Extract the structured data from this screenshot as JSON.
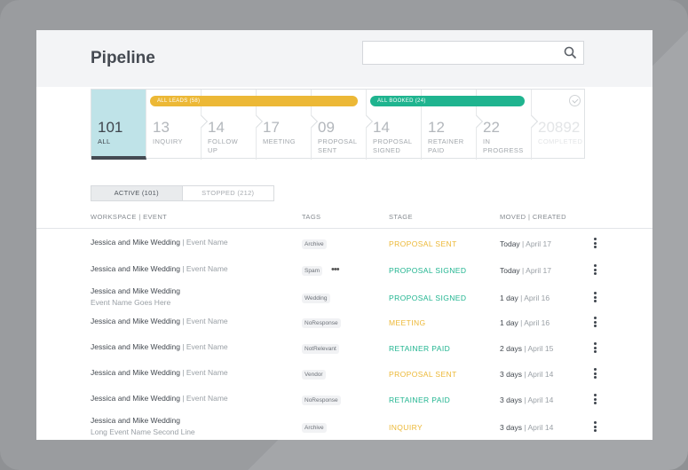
{
  "header": {
    "title": "Pipeline",
    "search_placeholder": ""
  },
  "stages": [
    {
      "count": "101",
      "label": "ALL"
    },
    {
      "count": "13",
      "label": "INQUIRY"
    },
    {
      "count": "14",
      "label": "FOLLOW UP"
    },
    {
      "count": "17",
      "label": "MEETING"
    },
    {
      "count": "09",
      "label": "PROPOSAL SENT"
    },
    {
      "count": "14",
      "label": "PROPOSAL SIGNED"
    },
    {
      "count": "12",
      "label": "RETAINER PAID"
    },
    {
      "count": "22",
      "label": "IN PROGRESS"
    },
    {
      "count": "20892",
      "label": "COMPLETED"
    }
  ],
  "groups": {
    "leads": "ALL LEADS (58)",
    "booked": "ALL BOOKED (24)"
  },
  "filters": {
    "active": "ACTIVE (101)",
    "stopped": "STOPPED (212)"
  },
  "columns": {
    "workspace": "WORKSPACE | EVENT",
    "tags": "TAGS",
    "stage": "STAGE",
    "moved": "MOVED | CREATED"
  },
  "colors": {
    "yellow": "#ecb836",
    "green": "#1fb48f",
    "all_bg": "#bfe3e8"
  },
  "rows": [
    {
      "name": "Jessica and Mike Wedding",
      "sep": " | ",
      "event": "Event Name",
      "tag": "Archive",
      "more": "",
      "stage": "PROPOSAL SENT",
      "stage_color": "#ecb836",
      "moved": "Today",
      "created": " | April 17"
    },
    {
      "name": "Jessica and Mike Wedding",
      "sep": " | ",
      "event": "Event Name",
      "tag": "Spam",
      "more": "•••",
      "stage": "PROPOSAL SIGNED",
      "stage_color": "#1fb48f",
      "moved": "Today",
      "created": " | April 17"
    },
    {
      "name": "Jessica and Mike Wedding",
      "sep": "",
      "event": "Event Name Goes Here",
      "tag": "Wedding",
      "more": "",
      "stage": "PROPOSAL SIGNED",
      "stage_color": "#1fb48f",
      "moved": "1 day",
      "created": " | April 16"
    },
    {
      "name": "Jessica and Mike Wedding",
      "sep": "  | ",
      "event": "Event Name",
      "tag": "NoResponse",
      "more": "",
      "stage": "MEETING",
      "stage_color": "#ecb836",
      "moved": "1 day",
      "created": " | April 16"
    },
    {
      "name": "Jessica and Mike Wedding",
      "sep": " | ",
      "event": "Event Name",
      "tag": "NotRelevant",
      "more": "",
      "stage": "RETAINER PAID",
      "stage_color": "#1fb48f",
      "moved": "2 days",
      "created": " | April 15"
    },
    {
      "name": "Jessica and Mike Wedding",
      "sep": "  | ",
      "event": "Event Name",
      "tag": "Vendor",
      "more": "",
      "stage": "PROPOSAL SENT",
      "stage_color": "#ecb836",
      "moved": "3 days",
      "created": " | April 14"
    },
    {
      "name": "Jessica and Mike Wedding",
      "sep": "  | ",
      "event": "Event Name",
      "tag": "NoResponse",
      "more": "",
      "stage": "RETAINER PAID",
      "stage_color": "#1fb48f",
      "moved": "3 days",
      "created": " | April 14"
    },
    {
      "name": "Jessica and Mike Wedding",
      "sep": "",
      "event": "Long Event Name Second Line",
      "tag": "Archive",
      "more": "",
      "stage": "INQUIRY",
      "stage_color": "#ecb836",
      "moved": "3 days",
      "created": " | April 14"
    }
  ]
}
